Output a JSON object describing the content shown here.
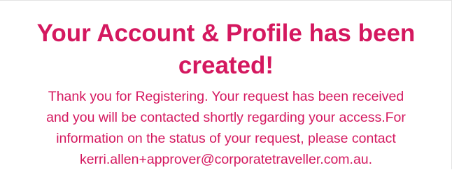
{
  "confirmation": {
    "title_lines": [
      "Your Account & Profile has been",
      "created!"
    ],
    "message_lines": [
      "Thank you for Registering. Your request has been received",
      "and you will be contacted shortly regarding your access.For",
      "information on the status of your request, please contact",
      "kerri.allen+approver@corporatetraveller.com.au."
    ]
  },
  "colors": {
    "accent": "#d4185f",
    "background": "#ffffff"
  }
}
